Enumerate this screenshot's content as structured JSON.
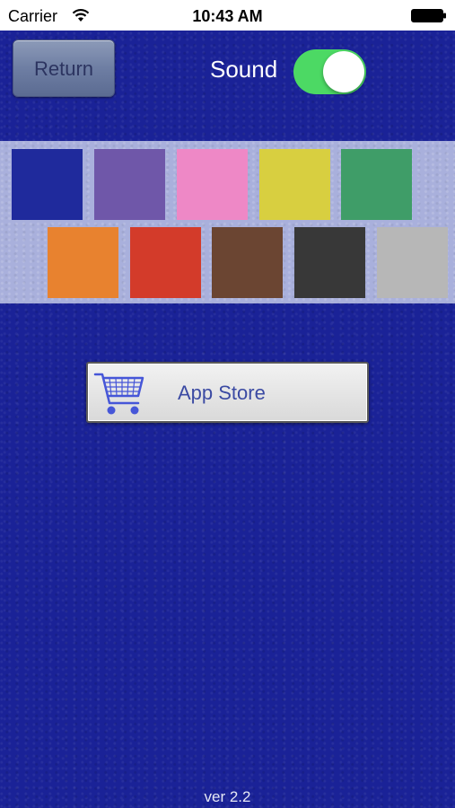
{
  "status_bar": {
    "carrier": "Carrier",
    "time": "10:43 AM",
    "wifi_icon": "wifi-icon",
    "battery_icon": "battery-icon"
  },
  "controls": {
    "return_label": "Return",
    "sound_label": "Sound",
    "sound_on": true,
    "toggle_color": "#4cd964"
  },
  "palette": {
    "row1": [
      "#1f2a9c",
      "#6f57a9",
      "#ee88c6",
      "#d8cf40",
      "#3f9d68"
    ],
    "row2": [
      "#e8822f",
      "#d33b2a",
      "#6b4532",
      "#383838",
      "#b7b7b7"
    ]
  },
  "appstore": {
    "label": "App Store",
    "icon": "shopping-cart-icon"
  },
  "footer": {
    "version": "ver 2.2"
  },
  "colors": {
    "background": "#1a2297",
    "palette_background": "#a9b0dc"
  }
}
